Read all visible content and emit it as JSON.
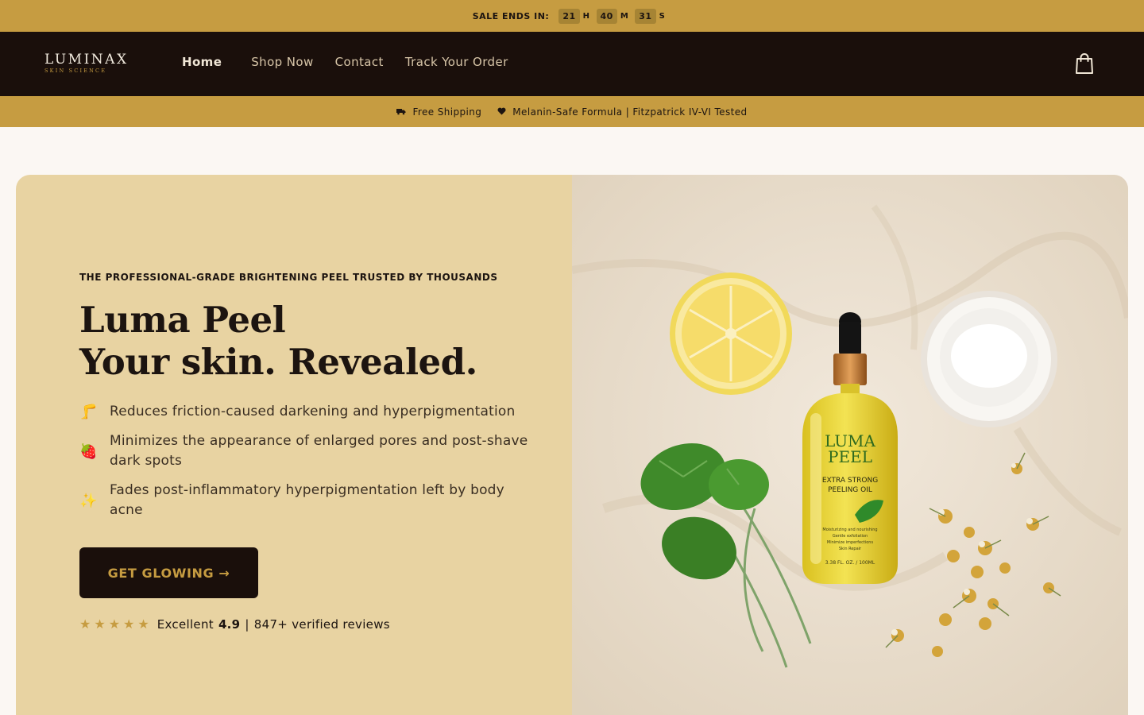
{
  "sale_bar": {
    "label": "SALE ENDS IN:",
    "hours": "21",
    "h": "H",
    "minutes": "40",
    "m": "M",
    "seconds": "31",
    "s": "S"
  },
  "brand": {
    "name": "LUMINAX",
    "tagline": "SKIN SCIENCE"
  },
  "nav": {
    "links": [
      "Home",
      "Shop Now",
      "Contact",
      "Track Your Order"
    ],
    "active": "Home"
  },
  "info_bar": {
    "shipping": "Free Shipping",
    "formula": "Melanin-Safe Formula | Fitzpatrick IV-VI Tested"
  },
  "hero": {
    "eyebrow": "THE PROFESSIONAL-GRADE BRIGHTENING PEEL TRUSTED BY THOUSANDS",
    "headline_1": "Luma Peel",
    "headline_2": "Your skin. Revealed.",
    "benefits": [
      {
        "emoji": "🦵",
        "text": "Reduces friction-caused darkening and hyperpigmentation"
      },
      {
        "emoji": "🍓",
        "text": "Minimizes the appearance of enlarged pores and post-shave dark spots"
      },
      {
        "emoji": "✨",
        "text": "Fades post-inflammatory hyperpigmentation left by body acne"
      }
    ],
    "cta": "GET GLOWING →",
    "rating_label": "Excellent",
    "rating_score": "4.9",
    "rating_sep": "|",
    "reviews": "847+ verified reviews",
    "stars_filled": 5
  },
  "product_label": {
    "name_1": "LUMA",
    "name_2": "PEEL",
    "desc_1": "EXTRA STRONG",
    "desc_2": "PEELING OIL",
    "small_1": "Moisturizing and nourishing",
    "small_2": "Gentle exfoliation",
    "small_3": "Minimize imperfections",
    "small_4": "Skin Repair",
    "volume": "3.38 FL. OZ. / 100ML"
  },
  "colors": {
    "gold": "#c69c41",
    "dark": "#1a0f0b",
    "cream": "#e8d3a2"
  }
}
